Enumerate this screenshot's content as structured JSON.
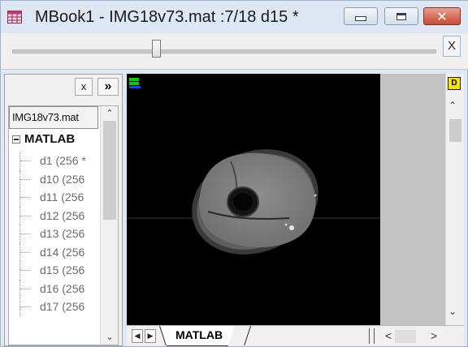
{
  "window": {
    "title": "MBook1 - IMG18v73.mat :7/18 d15 *",
    "close_glyph": "✕",
    "app_icon": "grid-book-icon"
  },
  "slider": {
    "close_label": "X",
    "position": 0.33
  },
  "left_panel": {
    "close_label": "x",
    "expand_label": "»",
    "tree": {
      "header": "IMG18v73.mat",
      "root": "MATLAB",
      "items": [
        "d1 (256 *",
        "d10 (256",
        "d11 (256",
        "d12 (256",
        "d13 (256",
        "d14 (256",
        "d15 (256",
        "d16 (256",
        "d17 (256"
      ]
    }
  },
  "viewer": {
    "badge_icon": "layer-badge-icon",
    "scroll_badge": "D"
  },
  "bottom": {
    "sheet_tab": "MATLAB",
    "prev": "◀",
    "next": "▶",
    "scroll_left": "<",
    "scroll_right": ">"
  },
  "colors": {
    "title_bar": "#dde7f4",
    "close_button": "#c74a33",
    "image_background": "#000000",
    "gray_pane": "#c3c3c3",
    "badge_yellow": "#f5e400"
  }
}
